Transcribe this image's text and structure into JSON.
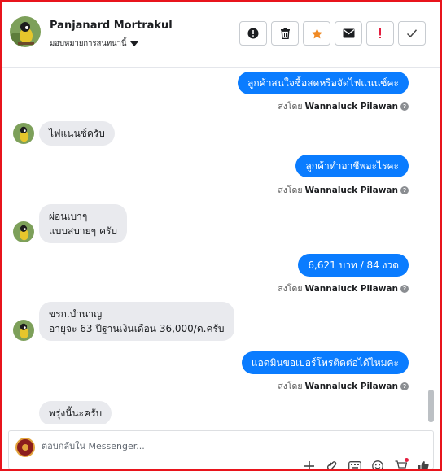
{
  "header": {
    "name": "Panjanard Mortrakul",
    "assign_label": "มอบหมายการสนทนานี้",
    "actions": [
      {
        "icon": "alert-circle-icon",
        "color": "#1c1e21"
      },
      {
        "icon": "trash-icon",
        "color": "#1c1e21"
      },
      {
        "icon": "star-icon",
        "color": "#f08a24"
      },
      {
        "icon": "envelope-icon",
        "color": "#1c1e21"
      },
      {
        "icon": "exclamation-icon",
        "color": "#e41e3f"
      },
      {
        "icon": "checkmark-icon",
        "color": "#1c1e21"
      }
    ]
  },
  "messages": {
    "m1": {
      "text": "ลูกค้าสนใจซื้อสดหรือจัดไฟแนนซ์คะ",
      "sender_prefix": "ส่งโดย",
      "sender_name": "Wannaluck Pilawan"
    },
    "m2": {
      "text": "ไฟแนนซ์ครับ"
    },
    "m3": {
      "text": "ลูกค้าทำอาชีพอะไรคะ",
      "sender_prefix": "ส่งโดย",
      "sender_name": "Wannaluck Pilawan"
    },
    "m4": {
      "line1": "ผ่อนเบาๆ",
      "line2": "แบบสบายๆ ครับ"
    },
    "m5": {
      "text": "6,621 บาท / 84 งวด",
      "sender_prefix": "ส่งโดย",
      "sender_name": "Wannaluck Pilawan"
    },
    "m6": {
      "line1": "ขรก.บำนาญ",
      "line2": "อายุจะ 63 ปีฐานเงินเดือน 36,000/ด.ครับ"
    },
    "m7": {
      "text": "แอดมินขอเบอร์โทรติดต่อได้ไหมคะ",
      "sender_prefix": "ส่งโดย",
      "sender_name": "Wannaluck Pilawan"
    },
    "m8": {
      "text": "พรุ่งนี้นะครับ"
    }
  },
  "reply": {
    "placeholder": "ตอบกลับใน Messenger..."
  },
  "colors": {
    "sent_bubble": "#0a7cff",
    "received_bubble": "#e9eaee",
    "frame_border": "#e8141c"
  }
}
